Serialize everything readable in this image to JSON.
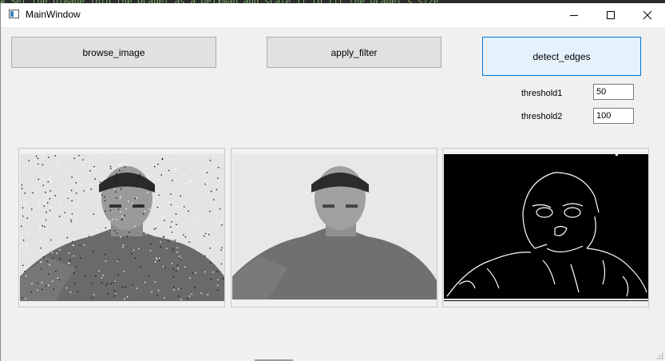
{
  "window": {
    "title": "MainWindow"
  },
  "code_line": "# Set the QImage into the QLabel as a QPixmap and scale it to fit the QLabel's size",
  "titlebar": {
    "minimize": "—",
    "maximize": "☐",
    "close": "✕"
  },
  "buttons": {
    "browse": "browse_image",
    "filter": "apply_filter",
    "edges": "detect_edges"
  },
  "thresholds": {
    "t1_label": "threshold1",
    "t1_value": "50",
    "t2_label": "threshold2",
    "t2_value": "100"
  },
  "colors": {
    "focus_border": "#0078d7",
    "focus_fill": "#e5f1fb",
    "button_fill": "#e1e1e1"
  }
}
